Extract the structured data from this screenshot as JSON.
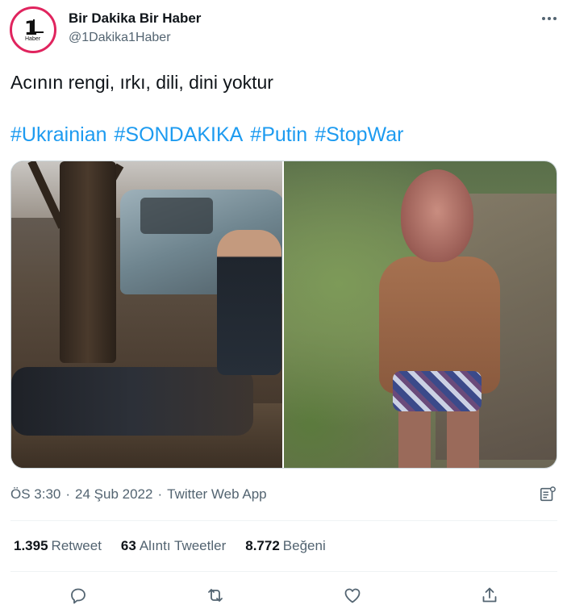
{
  "account": {
    "name": "Bir Dakika Bir Haber",
    "handle": "@1Dakika1Haber",
    "avatar_text": "1",
    "avatar_sub": "Haber"
  },
  "tweet": {
    "text": "Acının rengi, ırkı, dili, dini yoktur",
    "hashtags": [
      "#Ukrainian",
      "#SONDAKIKA",
      "#Putin",
      "#StopWar"
    ]
  },
  "meta": {
    "time": "ÖS 3:30",
    "separator": "·",
    "date": "24 Şub 2022",
    "app": "Twitter Web App"
  },
  "stats": {
    "retweets_count": "1.395",
    "retweets_label": "Retweet",
    "quotes_count": "63",
    "quotes_label": "Alıntı Tweetler",
    "likes_count": "8.772",
    "likes_label": "Beğeni"
  },
  "icons": {
    "more": "more-icon",
    "analytics": "analytics-icon",
    "reply": "reply-icon",
    "retweet": "retweet-icon",
    "like": "heart-icon",
    "share": "share-icon"
  },
  "colors": {
    "hashtag": "#1d9bf0",
    "secondary_text": "#536471",
    "avatar_ring": "#e0245e"
  }
}
